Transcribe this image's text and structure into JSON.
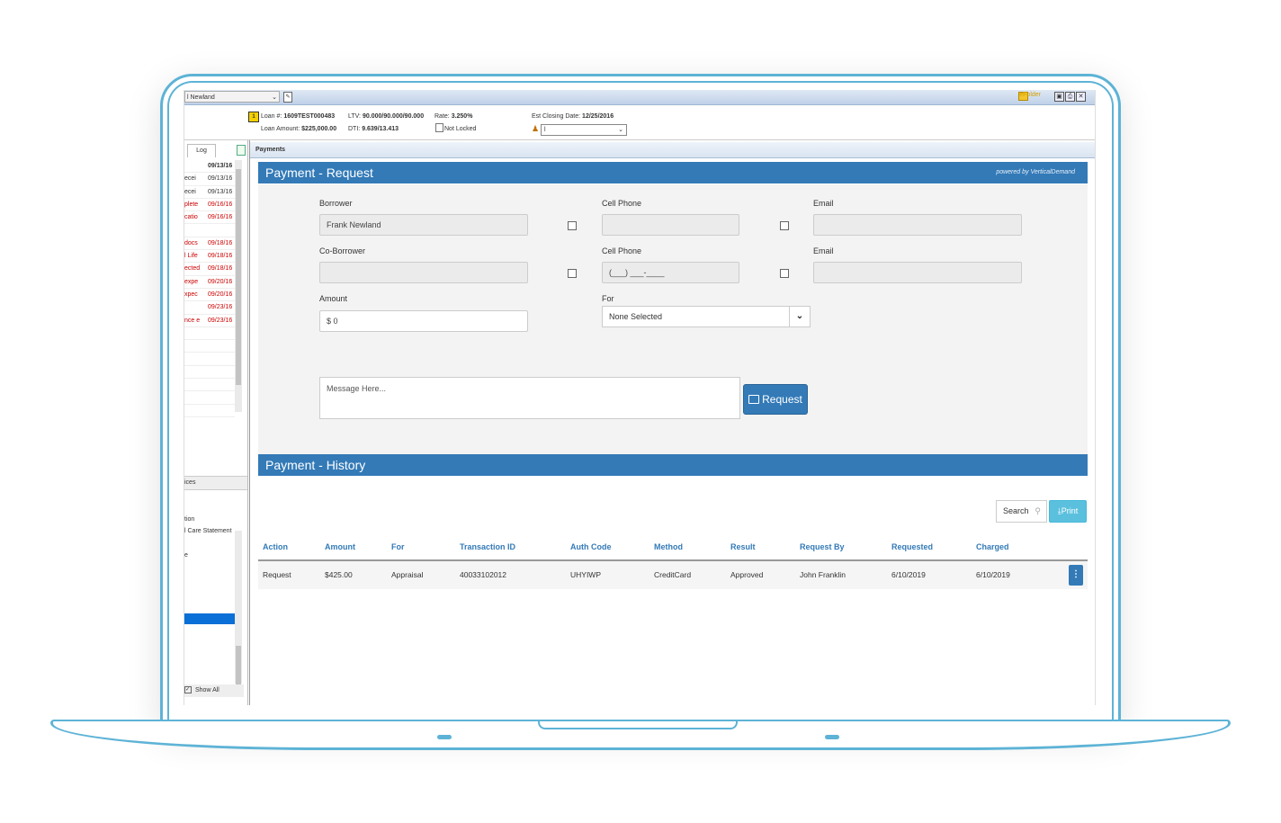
{
  "topbar": {
    "borrower_name": "l Newland",
    "efolder_label": "eFolder"
  },
  "loan": {
    "loan_num_label": "Loan #:",
    "loan_num": "1609TEST000483",
    "loan_amount_label": "Loan Amount:",
    "loan_amount": "$225,000.00",
    "ltv_label": "LTV:",
    "ltv": "90.000/90.000/90.000",
    "dti_label": "DTI:",
    "dti": "9.639/13.413",
    "rate_label": "Rate:",
    "rate": "3.250%",
    "lock_status": "Not Locked",
    "closing_label": "Est Closing Date:",
    "closing_date": "12/25/2016",
    "user_value": "l"
  },
  "left": {
    "log_tab": "Log",
    "log_rows": [
      {
        "t": "",
        "d": "09/13/16",
        "cls": "hdr"
      },
      {
        "t": "ecei",
        "d": "09/13/16",
        "cls": ""
      },
      {
        "t": "ecei",
        "d": "09/13/16",
        "cls": ""
      },
      {
        "t": "plete",
        "d": "09/16/16",
        "cls": "red"
      },
      {
        "t": "catio",
        "d": "09/16/16",
        "cls": "red"
      },
      {
        "t": "",
        "d": "",
        "cls": ""
      },
      {
        "t": "docs",
        "d": "09/18/16",
        "cls": "red"
      },
      {
        "t": "l Life",
        "d": "09/18/16",
        "cls": "red"
      },
      {
        "t": "ected",
        "d": "09/18/16",
        "cls": "red"
      },
      {
        "t": "expe",
        "d": "09/20/16",
        "cls": "red"
      },
      {
        "t": "xpec",
        "d": "09/20/16",
        "cls": "red"
      },
      {
        "t": "",
        "d": "09/23/16",
        "cls": "red"
      },
      {
        "t": "nce e",
        "d": "09/23/16",
        "cls": "red"
      },
      {
        "t": "",
        "d": "",
        "cls": ""
      },
      {
        "t": "",
        "d": "",
        "cls": ""
      },
      {
        "t": "",
        "d": "",
        "cls": ""
      },
      {
        "t": "",
        "d": "",
        "cls": ""
      },
      {
        "t": "",
        "d": "",
        "cls": ""
      },
      {
        "t": "",
        "d": "",
        "cls": ""
      },
      {
        "t": "",
        "d": "",
        "cls": ""
      }
    ],
    "services_header": "ices",
    "svc_item_1": "tion",
    "svc_item_2": "l Care Statement",
    "svc_item_3": "e",
    "show_all": "Show All"
  },
  "main": {
    "tab_label": "Payments",
    "request_title": "Payment - Request",
    "powered_by": "powered by VerticalDemand",
    "borrower_label": "Borrower",
    "borrower_value": "Frank Newland",
    "cell_phone_label": "Cell Phone",
    "email_label": "Email",
    "coborrower_label": "Co-Borrower",
    "cell_phone_label_2": "Cell Phone",
    "cell_phone_mask": "(___) ___-____",
    "email_label_2": "Email",
    "amount_label": "Amount",
    "amount_value": "$ 0",
    "for_label": "For",
    "for_value": "None Selected",
    "message_placeholder": "Message Here...",
    "request_button": "Request",
    "history_title": "Payment - History",
    "search_label": "Search",
    "print_button": "Print"
  },
  "history_table": {
    "headers": [
      "Action",
      "Amount",
      "For",
      "Transaction ID",
      "Auth Code",
      "Method",
      "Result",
      "Request By",
      "Requested",
      "Charged"
    ],
    "rows": [
      [
        "Request",
        "$425.00",
        "Appraisal",
        "40033102012",
        "UHYIWP",
        "CreditCard",
        "Approved",
        "John Franklin",
        "6/10/2019",
        "6/10/2019"
      ]
    ]
  },
  "colors": {
    "frame": "#5db3d6",
    "primary": "#337ab7",
    "info": "#5bc0de",
    "alert_text": "#cc0000"
  },
  "icons": [
    "edit-icon",
    "efolder-icon",
    "save-icon",
    "print-icon",
    "close-icon",
    "user-icon",
    "lock-icon",
    "new-document-icon",
    "credit-card-icon",
    "search-icon",
    "download-icon",
    "chevron-down-icon",
    "kebab-menu-icon"
  ]
}
